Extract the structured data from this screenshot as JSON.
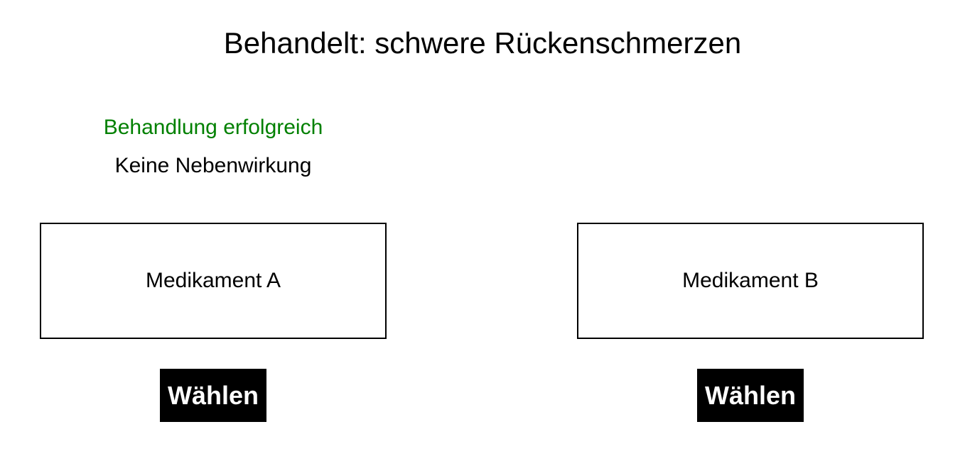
{
  "page": {
    "title": "Behandelt: schwere Rückenschmerzen"
  },
  "outcome": {
    "success_text": "Behandlung erfolgreich",
    "success_color": "#008000",
    "side_effect_text": "Keine Nebenwirkung"
  },
  "options": [
    {
      "label": "Medikament A",
      "button_label": "Wählen"
    },
    {
      "label": "Medikament B",
      "button_label": "Wählen"
    }
  ]
}
